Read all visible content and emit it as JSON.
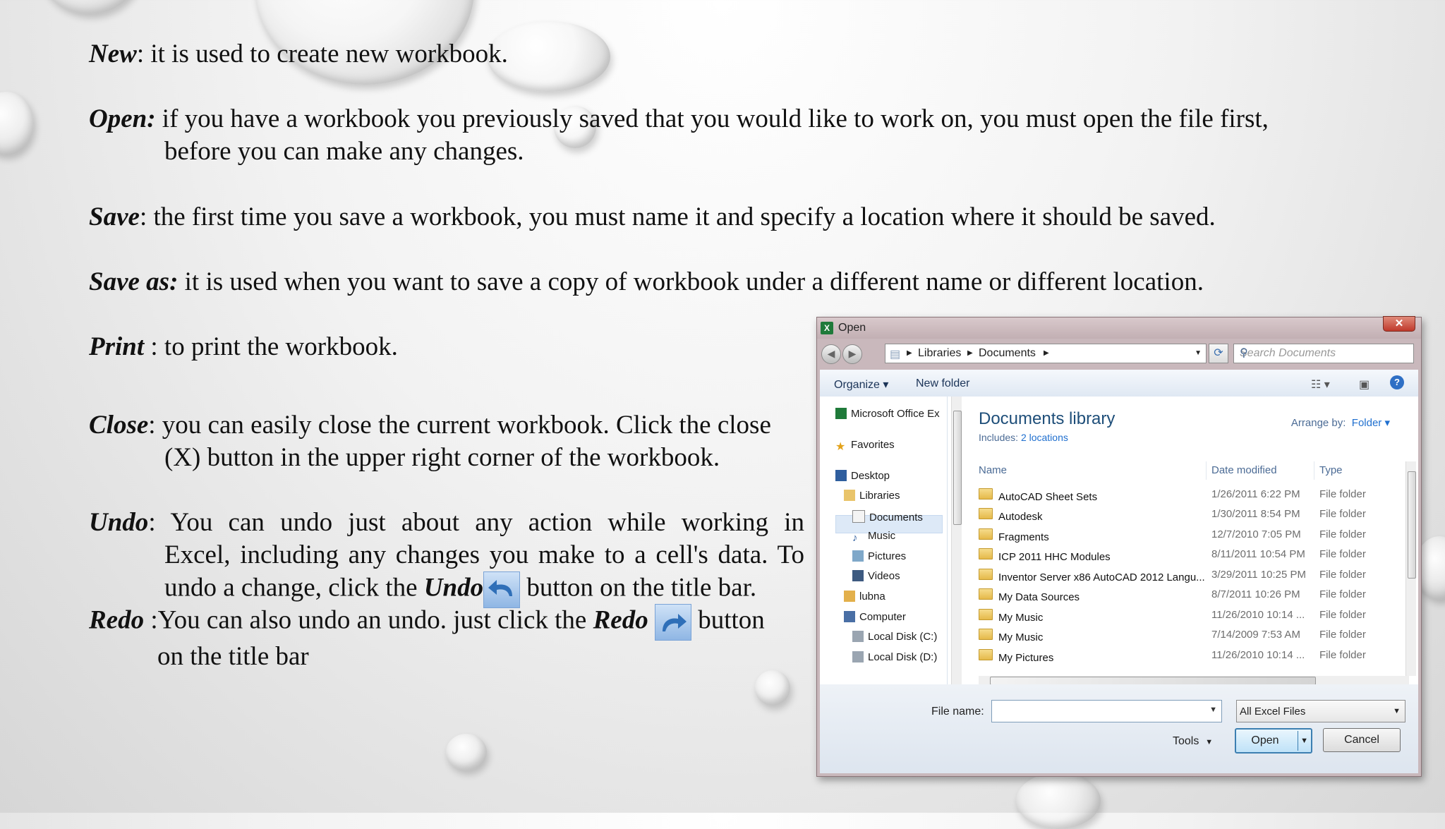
{
  "slide": {
    "new": {
      "term": "New",
      "text": ": it is used to create new workbook."
    },
    "open": {
      "term": "Open:",
      "text": " if you have a workbook you previously saved that you would like to work on, you must open the file first,",
      "text2": "before you can make any changes."
    },
    "save": {
      "term": "Save",
      "text": ": the first time you save a workbook, you must name it and specify a location where it should be saved."
    },
    "save_as": {
      "term": "Save as:",
      "text": " it is used when you want to save a copy of workbook under a different name or different location."
    },
    "print": {
      "term": "Print",
      "text": " : to print the workbook."
    },
    "close": {
      "term": "Close",
      "text": ": you can easily close the current workbook. Click the close",
      "text2": "(X) button in the upper right corner of the workbook."
    },
    "undo": {
      "term": "Undo",
      "line1": ":  You  can  undo  just  about  any  action  while  working  in",
      "line2": "Excel, including any changes you make to a cell's data. To",
      "line3a": "undo a change, click the ",
      "line3_term": "Undo",
      "line3b": " button on the title bar."
    },
    "redo": {
      "term": "Redo",
      "line1a": " :You can also undo an undo. just click the ",
      "line1_term": "Redo",
      "line1b": "  button",
      "line2": "on the title bar"
    }
  },
  "dialog": {
    "title": "Open",
    "address": {
      "part1": "Libraries",
      "part2": "Documents"
    },
    "search_placeholder": "Search Documents",
    "toolbar": {
      "organize": "Organize ▾",
      "new_folder": "New folder"
    },
    "nav": [
      "Microsoft Office Ex",
      "Favorites",
      "Desktop",
      "Libraries",
      "Documents",
      "Music",
      "Pictures",
      "Videos",
      "lubna",
      "Computer",
      "Local Disk (C:)",
      "Local Disk (D:)"
    ],
    "library_title": "Documents library",
    "includes_label": "Includes:",
    "includes_link": "2 locations",
    "arrange_label": "Arrange by:",
    "arrange_value": "Folder ▾",
    "columns": {
      "name": "Name",
      "date": "Date modified",
      "type": "Type"
    },
    "files": [
      {
        "name": "AutoCAD Sheet Sets",
        "date": "1/26/2011 6:22 PM",
        "type": "File folder"
      },
      {
        "name": "Autodesk",
        "date": "1/30/2011 8:54 PM",
        "type": "File folder"
      },
      {
        "name": "Fragments",
        "date": "12/7/2010 7:05 PM",
        "type": "File folder"
      },
      {
        "name": "ICP 2011 HHC Modules",
        "date": "8/11/2011 10:54 PM",
        "type": "File folder"
      },
      {
        "name": "Inventor Server x86 AutoCAD 2012 Langu...",
        "date": "3/29/2011 10:25 PM",
        "type": "File folder"
      },
      {
        "name": "My Data Sources",
        "date": "8/7/2011 10:26 PM",
        "type": "File folder"
      },
      {
        "name": "My Music",
        "date": "11/26/2010 10:14 ...",
        "type": "File folder"
      },
      {
        "name": "My Music",
        "date": "7/14/2009 7:53 AM",
        "type": "File folder"
      },
      {
        "name": "My Pictures",
        "date": "11/26/2010 10:14 ...",
        "type": "File folder"
      }
    ],
    "file_name_label": "File name:",
    "file_name_value": "",
    "file_type": "All Excel Files",
    "tools": "Tools",
    "open_button": "Open",
    "cancel_button": "Cancel",
    "close_glyph": "✕"
  }
}
